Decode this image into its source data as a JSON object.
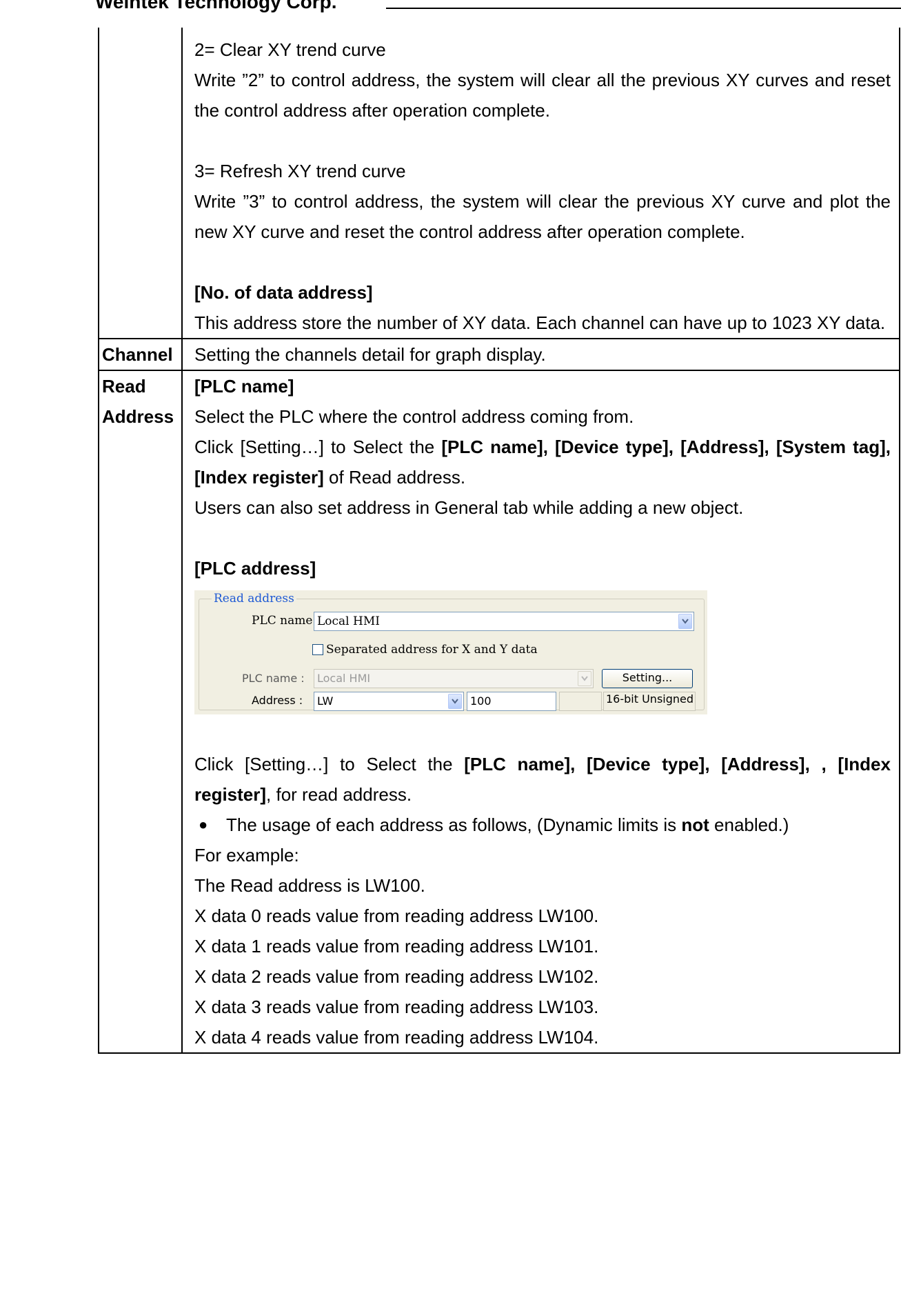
{
  "header": {
    "text": "Weintek Technology Corp."
  },
  "rows": [
    {
      "label": "",
      "c2": {
        "clear_title": "2= Clear XY trend curve",
        "clear_desc": "Write ”2” to control address, the system will clear all the previous XY curves and reset the control address after operation complete.",
        "refresh_title": "3= Refresh XY trend curve",
        "refresh_desc": "Write ”3” to control address, the system will clear the previous XY curve and plot the new XY curve and reset the control address after operation complete.",
        "nodata_heading": "[No. of data address]",
        "nodata_desc": "This address store the number of XY data. Each channel can have up to 1023 XY data."
      }
    },
    {
      "label": "Channel",
      "c2": {
        "text": "Setting the channels detail for graph display."
      }
    },
    {
      "label_line1": "Read",
      "label_line2": "Address",
      "c2": {
        "plcname_heading": "[PLC name]",
        "select_text": "Select the PLC where the control address coming from.",
        "click1_a": "Click [Setting…] to Select the ",
        "click1_b": "[PLC name], [Device type], [Address],",
        "click1_c": "[System tag], [Index register]",
        "click1_d": " of Read address.",
        "users_text": "Users can also set address in General tab while adding a new object.",
        "plcaddr_heading": "[PLC address]",
        "click2_a": "Click [Setting…] to Select the ",
        "click2_b": "[PLC name], [Device type], [Address], ,",
        "click2_c": "[Index register]",
        "click2_d": ", for read address.",
        "bullet_a": "The usage of each address as follows, (Dynamic limits is ",
        "bullet_b": "not",
        "bullet_c": " enabled.)",
        "example_label": "For example:",
        "read_is": "The Read address is LW100.",
        "x_lines": [
          "X data 0 reads value from reading address LW100.",
          "X data 1 reads value from reading address LW101.",
          "X data 2 reads value from reading address LW102.",
          "X data 3 reads value from reading address LW103.",
          "X data 4 reads value from reading address LW104."
        ]
      }
    }
  ],
  "dialog": {
    "legend": "Read address",
    "plc_name_label": "PLC name :",
    "plc_name_value": "Local HMI",
    "separated_label": "Separated address for X and Y data",
    "separated_checked": false,
    "plc_name2_label": "PLC name :",
    "plc_name2_value": "Local HMI",
    "setting_button": "Setting...",
    "address_label": "Address :",
    "device_type": "LW",
    "address_value": "100",
    "data_format": "16-bit Unsigned"
  }
}
